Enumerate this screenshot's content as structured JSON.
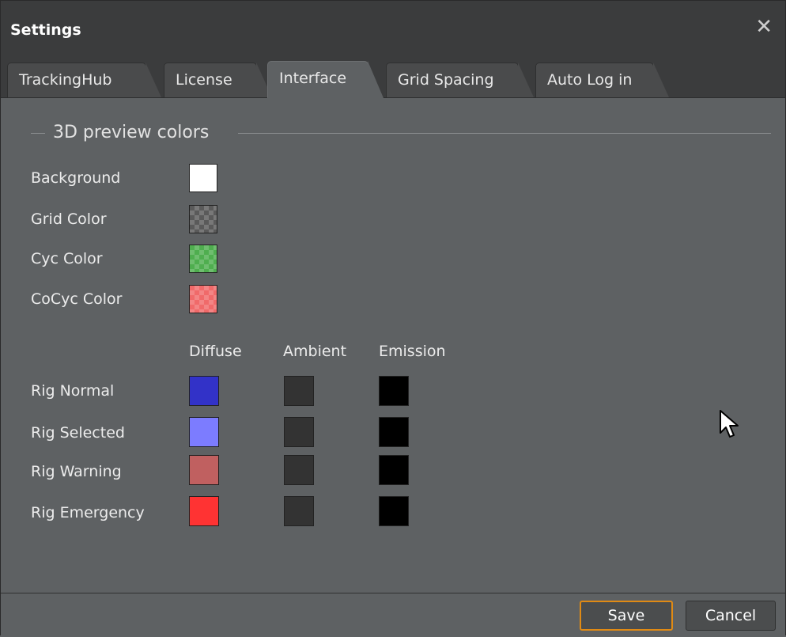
{
  "window": {
    "title": "Settings"
  },
  "tabs": [
    {
      "label": "TrackingHub",
      "active": false
    },
    {
      "label": "License",
      "active": false
    },
    {
      "label": "Interface",
      "active": true
    },
    {
      "label": "Grid Spacing",
      "active": false
    },
    {
      "label": "Auto Log in",
      "active": false
    }
  ],
  "section": {
    "title": "3D preview colors"
  },
  "preview_colors": [
    {
      "label": "Background",
      "color": "#ffffff",
      "pattern": "solid"
    },
    {
      "label": "Grid Color",
      "color": "#5a5a5a",
      "pattern": "checker"
    },
    {
      "label": "Cyc Color",
      "color": "#4fae4f",
      "pattern": "checker"
    },
    {
      "label": "CoCyc Color",
      "color": "#f06a6a",
      "pattern": "checker"
    }
  ],
  "rig_columns": [
    "Diffuse",
    "Ambient",
    "Emission"
  ],
  "rig_rows": [
    {
      "label": "Rig Normal",
      "diffuse": "#3232c8",
      "ambient": "#333333",
      "emission": "#000000"
    },
    {
      "label": "Rig Selected",
      "diffuse": "#7c7cff",
      "ambient": "#333333",
      "emission": "#000000"
    },
    {
      "label": "Rig Warning",
      "diffuse": "#c06060",
      "ambient": "#333333",
      "emission": "#000000"
    },
    {
      "label": "Rig Emergency",
      "diffuse": "#ff3333",
      "ambient": "#333333",
      "emission": "#000000"
    }
  ],
  "footer": {
    "save_label": "Save",
    "cancel_label": "Cancel"
  }
}
